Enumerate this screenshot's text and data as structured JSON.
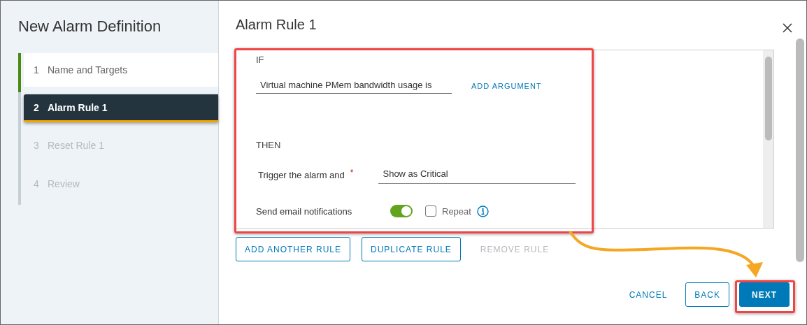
{
  "wizard": {
    "title": "New Alarm Definition",
    "steps": [
      {
        "number": "1",
        "label": "Name and Targets",
        "completed": true,
        "selected": false,
        "disabled": false
      },
      {
        "number": "2",
        "label": "Alarm Rule 1",
        "completed": false,
        "selected": true,
        "disabled": false
      },
      {
        "number": "3",
        "label": "Reset Rule 1",
        "completed": false,
        "selected": false,
        "disabled": true
      },
      {
        "number": "4",
        "label": "Review",
        "completed": false,
        "selected": false,
        "disabled": true
      }
    ]
  },
  "main": {
    "title": "Alarm Rule 1",
    "rule": {
      "if_label": "IF",
      "condition": {
        "value": "Virtual machine PMem bandwidth usage is"
      },
      "add_argument": "ADD ARGUMENT",
      "then_label": "THEN",
      "trigger": {
        "label": "Trigger the alarm and",
        "required": true,
        "required_mark": "*",
        "value": "Show as Critical"
      },
      "email": {
        "label": "Send email notifications",
        "on": true
      },
      "repeat": {
        "label": "Repeat",
        "checked": false
      }
    },
    "rule_buttons": [
      {
        "label": "ADD ANOTHER RULE",
        "disabled": false
      },
      {
        "label": "DUPLICATE RULE",
        "disabled": false
      },
      {
        "label": "REMOVE RULE",
        "disabled": true
      }
    ],
    "footer_buttons": [
      {
        "label": "CANCEL",
        "kind": "flat"
      },
      {
        "label": "BACK",
        "kind": "outline"
      },
      {
        "label": "NEXT",
        "kind": "primary"
      }
    ]
  }
}
